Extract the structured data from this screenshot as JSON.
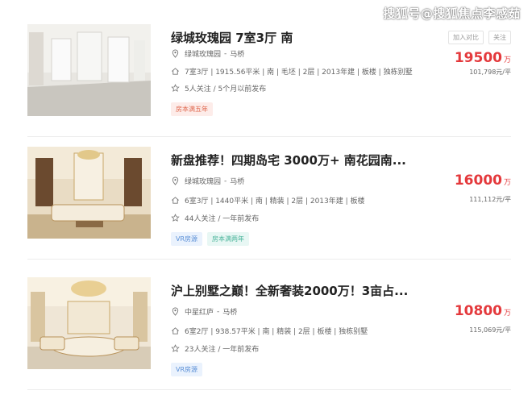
{
  "watermark": "搜狐号@搜狐焦点李感茹",
  "listings": [
    {
      "title": "绿城玫瑰园 7室3厅 南",
      "community": "绿城玫瑰园",
      "area": "马桥",
      "details": "7室3厅 | 1915.56平米 | 南 | 毛坯 | 2层 | 2013年建 | 板楼 | 独栋别墅",
      "follow": "5人关注 / 5个月以前发布",
      "tags": [
        {
          "label": "房本满五年",
          "style": "red"
        }
      ],
      "price": "19500",
      "price_unit": "万",
      "unit_price": "101,798元/平",
      "compare_label": "加入对比",
      "follow_btn_label": "关注"
    },
    {
      "title": "新盘推荐！四期岛宅 3000万+ 南花园南...",
      "community": "绿城玫瑰园",
      "area": "马桥",
      "details": "6室3厅 | 1440平米 | 南 | 精装 | 2层 | 2013年建 | 板楼",
      "follow": "44人关注 / 一年前发布",
      "tags": [
        {
          "label": "VR房源",
          "style": "blue"
        },
        {
          "label": "房本满两年",
          "style": "teal"
        }
      ],
      "price": "16000",
      "price_unit": "万",
      "unit_price": "111,112元/平"
    },
    {
      "title": "沪上别墅之巅！全新奢装2000万！3亩占...",
      "community": "中星红庐",
      "area": "马桥",
      "details": "6室2厅 | 938.57平米 | 南 | 精装 | 2层 | 板楼 | 独栋别墅",
      "follow": "23人关注 / 一年前发布",
      "tags": [
        {
          "label": "VR房源",
          "style": "blue"
        }
      ],
      "price": "10800",
      "price_unit": "万",
      "unit_price": "115,069元/平"
    }
  ],
  "icons": {
    "location": "location-pin-icon",
    "home": "house-icon",
    "star": "star-icon"
  },
  "colors": {
    "price": "#e4393c",
    "title": "#222222",
    "tag_red_bg": "#fdece9",
    "tag_blue_bg": "#eaf2fd",
    "tag_teal_bg": "#e8f7f4"
  }
}
